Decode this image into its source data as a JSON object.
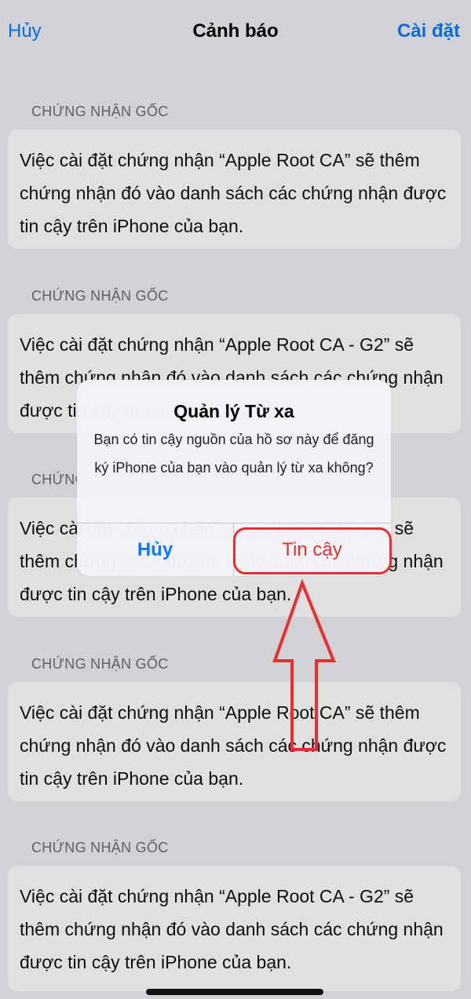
{
  "nav": {
    "cancel_label": "Hủy",
    "title": "Cảnh báo",
    "install_label": "Cài đặt"
  },
  "sections": [
    {
      "header": "CHỨNG NHẬN GỐC",
      "body": "Việc cài đặt chứng nhận “Apple Root CA” sẽ thêm chứng nhận đó vào danh sách các chứng nhận được tin cậy trên iPhone của bạn."
    },
    {
      "header": "CHỨNG NHẬN GỐC",
      "body": "Việc cài đặt chứng nhận “Apple Root CA - G2” sẽ thêm chứng nhận đó vào danh sách các chứng nhận được tin cậy trên iPhone của bạn."
    },
    {
      "header": "CHỨNG NHẬN GỐC",
      "body": "Việc cài đặt chứng nhận “Apple Root CA - G3” sẽ thêm chứng nhận đó vào danh sách các chứng nhận được tin cậy trên iPhone của bạn."
    },
    {
      "header": "CHỨNG NHẬN GỐC",
      "body": "Việc cài đặt chứng nhận “Apple Root CA” sẽ thêm chứng nhận đó vào danh sách các chứng nhận được tin cậy trên iPhone của bạn."
    },
    {
      "header": "CHỨNG NHẬN GỐC",
      "body": "Việc cài đặt chứng nhận “Apple Root CA - G2” sẽ thêm chứng nhận đó vào danh sách các chứng nhận được tin cậy trên iPhone của bạn."
    }
  ],
  "alert": {
    "title": "Quản lý Từ xa",
    "message": "Bạn có tin cậy nguồn của hồ sơ này để đăng ký iPhone của bạn vào quản lý từ xa không?",
    "cancel_label": "Hủy",
    "trust_label": "Tin cậy"
  },
  "colors": {
    "accent": "#0a7aff",
    "destructive": "#e0322e",
    "annotation": "#e62f2f"
  }
}
